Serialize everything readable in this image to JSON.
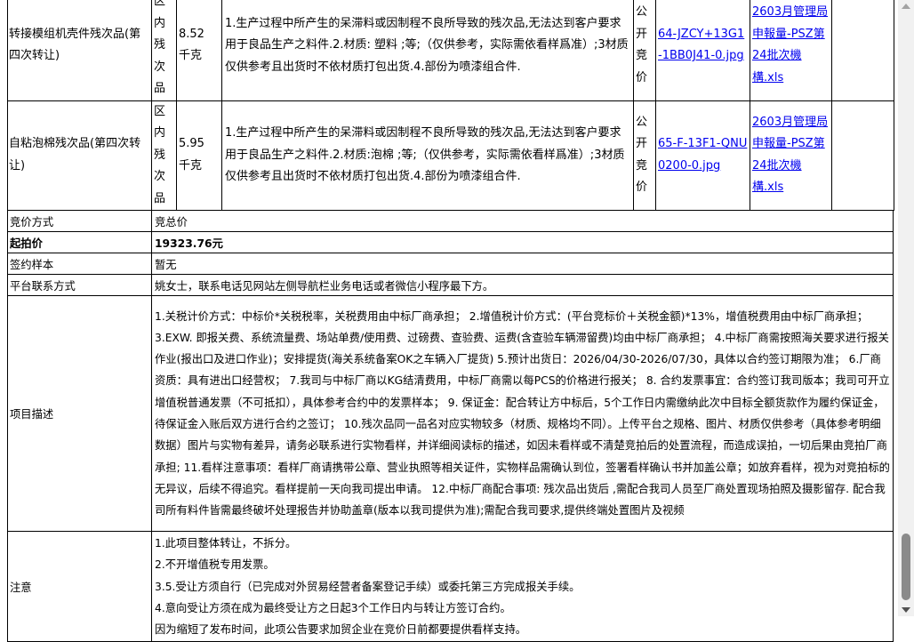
{
  "items": [
    {
      "name": "转接模组机壳件残次品(第四次转让)",
      "location": "区内残次品",
      "weight": "8.52 千克",
      "description": "1.生产过程中所产生的呆滞料或因制程不良所导致的残次品,无法达到客户要求用于良品生产之料件.2.材质: 塑料 ;等;（仅供参考，实际需依看样爲准）;3材质仅供参考且出货时不依材质打包出货.4.部份为喷漆组合件.",
      "method": "公开竞价",
      "image": "64-JZCY+13G1-1BB0J41-0.jpg",
      "file": "2603月管理局申報量-PSZ第24批次機構.xls"
    },
    {
      "name": "自粘泡棉残次品(第四次转让)",
      "location": "区内残次品",
      "weight": "5.95 千克",
      "description": "1.生产过程中所产生的呆滞料或因制程不良所导致的残次品,无法达到客户要求用于良品生产之料件.2.材质:泡棉 ;等;（仅供参考，实际需依看样爲准）;3材质仅供参考且出货时不依材质打包出货.4.部份为喷漆组合件.",
      "method": "公开竞价",
      "image": "65-F-13F1-QNU0200-0.jpg",
      "file": "2603月管理局申報量-PSZ第24批次機構.xls"
    }
  ],
  "info": {
    "bid_method_label": "竞价方式",
    "bid_method_value": "竞总价",
    "start_price_label": "起拍价",
    "start_price_value": "19323.76元",
    "contract_label": "签约样本",
    "contract_value": "暂无",
    "contact_label": "平台联系方式",
    "contact_value": "姚女士，联系电话见网站左侧导航栏业务电话或者微信小程序最下方。",
    "desc_label": "项目描述",
    "desc_value": "1.关税计价方式：中标价*关税税率，关税费用由中标厂商承担； 2.增值税计价方式：(平台竞标价＋关税金额)*13%，增值税费用由中标厂商承担； 3.EXW. 即报关费、系统流量费、场站单费/使用费、过磅费、查验费、运费(含查验车辆滞留费)均由中标厂商承担； 4.中标厂商需按照海关要求进行报关作业(报出口及进口作业)；安排提货(海关系统备案OK之车辆入厂提货) 5.预计出货日：2026/04/30-2026/07/30，具体以合约签订期限为准； 6.厂商资质：具有进出口经营权； 7.我司与中标厂商以KG结清费用，中标厂商需以每PCS的价格进行报关； 8. 合约发票事宜：合约签订我司版本；我司可开立增值税普通发票（不可抵扣），具体参考合约中的发票样本； 9. 保证金：配合转让方中标后，5个工作日内需缴纳此次中目标全额货款作为履约保证金，待保证金入账后双方进行合约之签订； 10.残次品同一品名对应实物较多（材质、规格均不同）。上传平台之规格、图片、材质仅供参考（具体参考明细数据）图片与实物有差异，请务必联系进行实物看样，并详细阅读标的描述，如因未看样或不清楚竞拍后的处置流程，而造成误拍，一切后果由竞拍厂商承担; 11.看样注意事项：看样厂商请携带公章、营业执照等相关证件，实物样品需确认到位，签署看样确认书并加盖公章；如放弃看样，视为对竞拍标的无异议，后续不得追究。看样提前一天向我司提出申请。 12.中标厂商配合事项: 残次品出货后 ,需配合我司人员至厂商处置现场拍照及摄影留存. 配合我司所有料件皆需最终破坏处理报告并协助盖章(版本以我司提供为准);需配合我司要求,提供终端处置图片及视频",
    "notes_label": "注意",
    "notes": [
      "1.此项目整体转让，不拆分。",
      "2.不开增值税专用发票。",
      "3.5.受让方须自行（已完成对外贸易经营者备案登记手续）或委托第三方完成报关手续。",
      "4.意向受让方须在成为最终受让方之日起3个工作日内与转让方签订合约。",
      "因为缩短了发布时间，此项公告要求加贸企业在竞价日前都要提供看样支持。"
    ]
  },
  "colors": {
    "link": "#0000ee",
    "border": "#000000",
    "scrollbar_thumb": "#8a8a8a"
  }
}
